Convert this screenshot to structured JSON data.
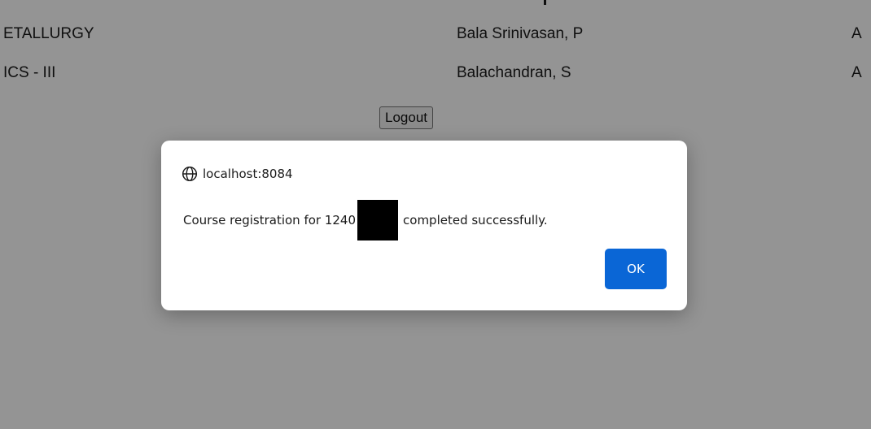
{
  "table": {
    "rows": [
      {
        "course": "ETALLURGY",
        "faculty": "Bala Srinivasan, P",
        "status": "A"
      },
      {
        "course": "ICS - III",
        "faculty": "Balachandran, S",
        "status": "A"
      }
    ]
  },
  "page": {
    "logout_label": "Logout"
  },
  "dialog": {
    "origin": "localhost:8084",
    "message_prefix": "Course registration for 1240",
    "message_suffix": "completed successfully.",
    "ok_label": "OK",
    "ok_color": "#0a66d6"
  }
}
